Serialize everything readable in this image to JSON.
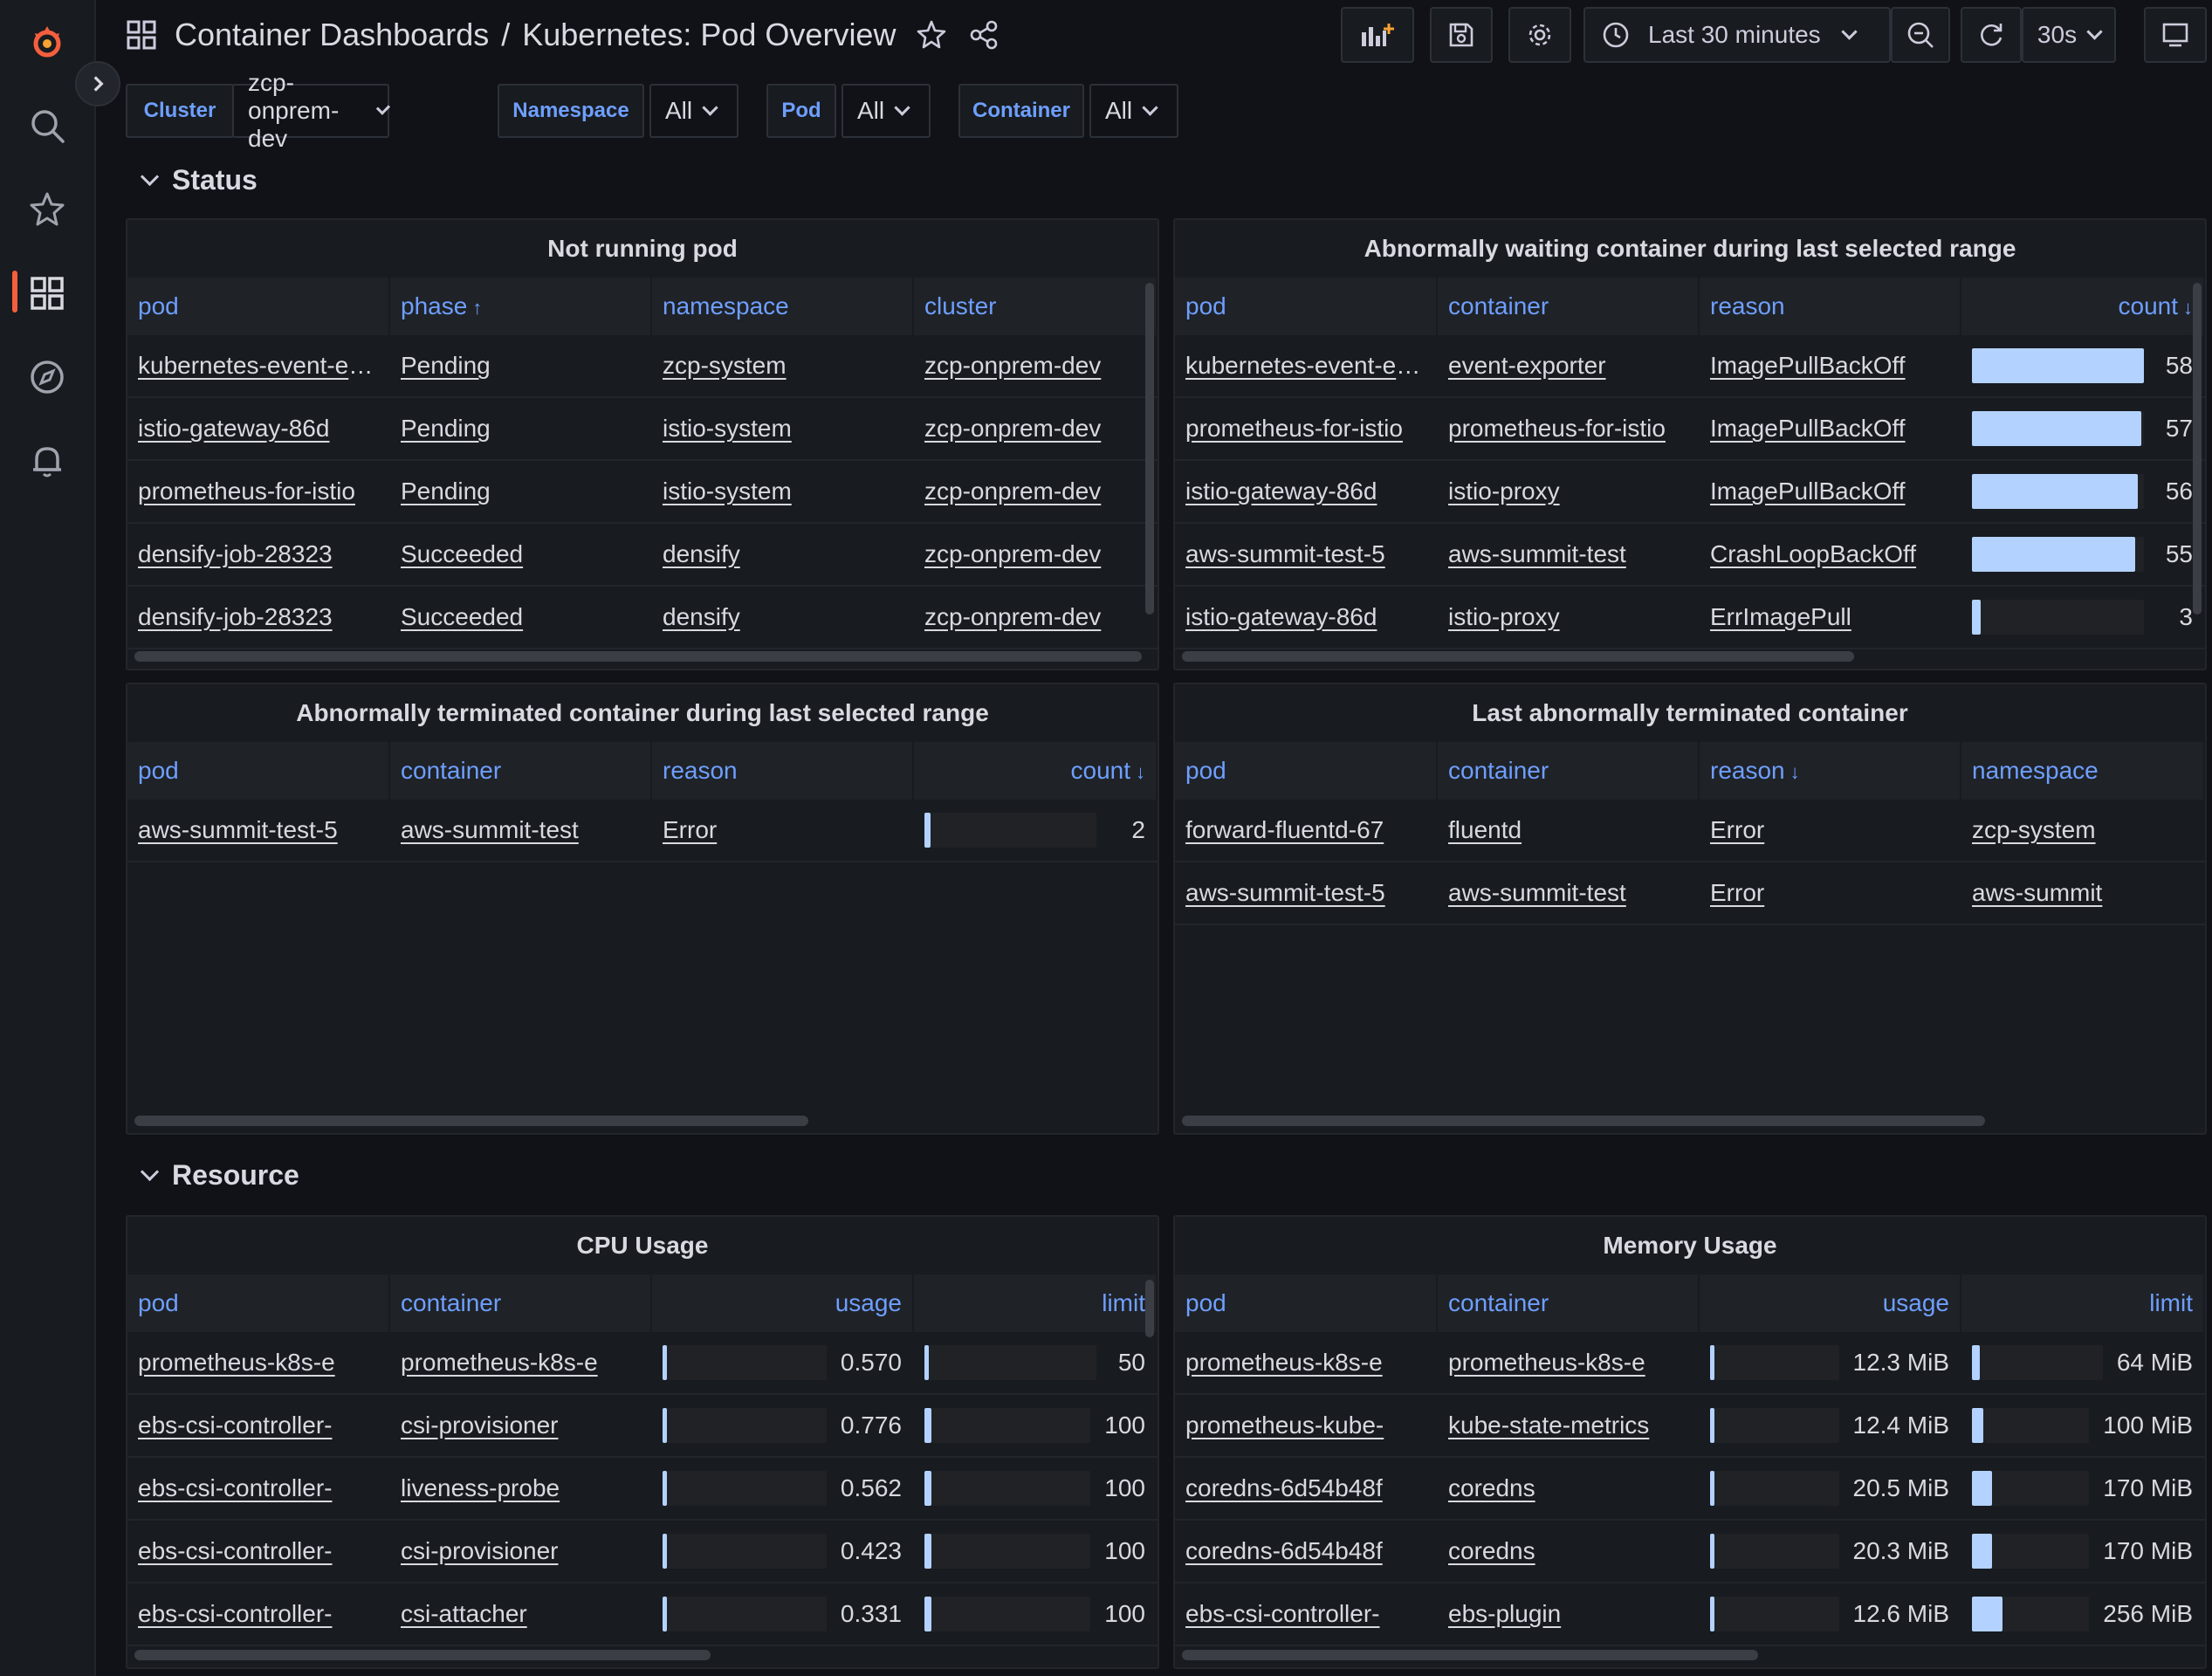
{
  "breadcrumb": {
    "folder": "Container Dashboards",
    "separator": "/",
    "dashboard": "Kubernetes: Pod Overview"
  },
  "time_picker": {
    "label": "Last 30 minutes"
  },
  "refresh": {
    "interval": "30s"
  },
  "variables": [
    {
      "label": "Cluster",
      "value": "zcp-onprem-dev"
    },
    {
      "label": "Namespace",
      "value": "All"
    },
    {
      "label": "Pod",
      "value": "All"
    },
    {
      "label": "Container",
      "value": "All"
    }
  ],
  "rows": {
    "status": "Status",
    "resource": "Resource"
  },
  "colors": {
    "accent": "#6e9fff",
    "bar_fill": "#b3d2ff",
    "brand": "#f55f3e",
    "background": "#111217",
    "panel": "#181b1f"
  },
  "panels": {
    "not_running": {
      "title": "Not running pod",
      "columns": [
        "pod",
        "phase",
        "namespace",
        "cluster"
      ],
      "sort_arrow": "↑",
      "rows": [
        [
          "kubernetes-event-exporter",
          "Pending",
          "zcp-system",
          "zcp-onprem-dev"
        ],
        [
          "istio-gateway-86d",
          "Pending",
          "istio-system",
          "zcp-onprem-dev"
        ],
        [
          "prometheus-for-istio",
          "Pending",
          "istio-system",
          "zcp-onprem-dev"
        ],
        [
          "densify-job-28323",
          "Succeeded",
          "densify",
          "zcp-onprem-dev"
        ],
        [
          "densify-job-28323",
          "Succeeded",
          "densify",
          "zcp-onprem-dev"
        ]
      ]
    },
    "waiting": {
      "title": "Abnormally waiting container during last selected range",
      "columns": [
        "pod",
        "container",
        "reason",
        "count"
      ],
      "sort_arrow": "↓",
      "max": 58,
      "rows": [
        {
          "pod": "kubernetes-event-exporter",
          "container": "event-exporter",
          "reason": "ImagePullBackOff",
          "count": 58
        },
        {
          "pod": "prometheus-for-istio",
          "container": "prometheus-for-istio",
          "reason": "ImagePullBackOff",
          "count": 57
        },
        {
          "pod": "istio-gateway-86d",
          "container": "istio-proxy",
          "reason": "ImagePullBackOff",
          "count": 56
        },
        {
          "pod": "aws-summit-test-5",
          "container": "aws-summit-test",
          "reason": "CrashLoopBackOff",
          "count": 55
        },
        {
          "pod": "istio-gateway-86d",
          "container": "istio-proxy",
          "reason": "ErrImagePull",
          "count": 3
        }
      ]
    },
    "terminated": {
      "title": "Abnormally terminated container during last selected range",
      "columns": [
        "pod",
        "container",
        "reason",
        "count"
      ],
      "sort_arrow": "↓",
      "max": 58,
      "rows": [
        {
          "pod": "aws-summit-test-5",
          "container": "aws-summit-test",
          "reason": "Error",
          "count": 2
        }
      ]
    },
    "last_terminated": {
      "title": "Last abnormally terminated container",
      "columns": [
        "pod",
        "container",
        "reason",
        "namespace"
      ],
      "sort_arrow": "↓",
      "rows": [
        [
          "forward-fluentd-67",
          "fluentd",
          "Error",
          "zcp-system"
        ],
        [
          "aws-summit-test-5",
          "aws-summit-test",
          "Error",
          "aws-summit"
        ]
      ]
    },
    "cpu": {
      "title": "CPU Usage",
      "columns": [
        "pod",
        "container",
        "usage",
        "limit"
      ],
      "rows": [
        {
          "pod": "prometheus-k8s-e",
          "container": "prometheus-k8s-e",
          "usage": "0.570",
          "usage_frac": 0.01,
          "limit": "50",
          "limit_frac": 0.02
        },
        {
          "pod": "ebs-csi-controller-",
          "container": "csi-provisioner",
          "usage": "0.776",
          "usage_frac": 0.01,
          "limit": "100",
          "limit_frac": 0.04
        },
        {
          "pod": "ebs-csi-controller-",
          "container": "liveness-probe",
          "usage": "0.562",
          "usage_frac": 0.01,
          "limit": "100",
          "limit_frac": 0.04
        },
        {
          "pod": "ebs-csi-controller-",
          "container": "csi-provisioner",
          "usage": "0.423",
          "usage_frac": 0.01,
          "limit": "100",
          "limit_frac": 0.04
        },
        {
          "pod": "ebs-csi-controller-",
          "container": "csi-attacher",
          "usage": "0.331",
          "usage_frac": 0.01,
          "limit": "100",
          "limit_frac": 0.04
        }
      ]
    },
    "memory": {
      "title": "Memory Usage",
      "columns": [
        "pod",
        "container",
        "usage",
        "limit"
      ],
      "rows": [
        {
          "pod": "prometheus-k8s-e",
          "container": "prometheus-k8s-e",
          "usage": "12.3 MiB",
          "usage_frac": 0.01,
          "limit": "64 MiB",
          "limit_frac": 0.06
        },
        {
          "pod": "prometheus-kube-",
          "container": "kube-state-metrics",
          "usage": "12.4 MiB",
          "usage_frac": 0.01,
          "limit": "100 MiB",
          "limit_frac": 0.1
        },
        {
          "pod": "coredns-6d54b48f",
          "container": "coredns",
          "usage": "20.5 MiB",
          "usage_frac": 0.01,
          "limit": "170 MiB",
          "limit_frac": 0.17
        },
        {
          "pod": "coredns-6d54b48f",
          "container": "coredns",
          "usage": "20.3 MiB",
          "usage_frac": 0.01,
          "limit": "170 MiB",
          "limit_frac": 0.17
        },
        {
          "pod": "ebs-csi-controller-",
          "container": "ebs-plugin",
          "usage": "12.6 MiB",
          "usage_frac": 0.01,
          "limit": "256 MiB",
          "limit_frac": 0.26
        }
      ]
    }
  }
}
